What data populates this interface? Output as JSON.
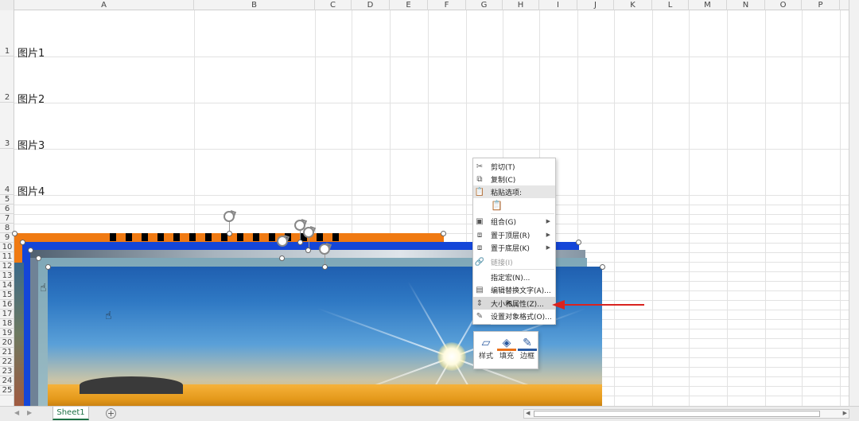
{
  "columns": [
    "A",
    "B",
    "C",
    "D",
    "E",
    "F",
    "G",
    "H",
    "I",
    "J",
    "K",
    "L",
    "M",
    "N",
    "O",
    "P"
  ],
  "rows": [
    "1",
    "2",
    "3",
    "4",
    "5",
    "6",
    "7",
    "8",
    "9",
    "10",
    "11",
    "12",
    "13",
    "14",
    "15",
    "16",
    "17",
    "18",
    "19",
    "20",
    "21",
    "22",
    "23",
    "24",
    "25"
  ],
  "cells": [
    {
      "row": "1",
      "text": "图片1"
    },
    {
      "row": "2",
      "text": "图片2"
    },
    {
      "row": "3",
      "text": "图片3"
    },
    {
      "row": "4",
      "text": "图片4"
    }
  ],
  "context_menu": {
    "items": [
      {
        "label": "剪切(T)",
        "icon": "cut-icon",
        "glyph": "✂"
      },
      {
        "label": "复制(C)",
        "icon": "copy-icon",
        "glyph": "⧉"
      },
      {
        "label": "粘贴选项:",
        "icon": "paste-icon",
        "glyph": "📋"
      },
      {
        "label": "组合(G)",
        "icon": "group-icon",
        "glyph": "▣",
        "submenu": true
      },
      {
        "label": "置于顶层(R)",
        "icon": "bring-front-icon",
        "glyph": "⧈",
        "submenu": true
      },
      {
        "label": "置于底层(K)",
        "icon": "send-back-icon",
        "glyph": "⧈",
        "submenu": true
      },
      {
        "label": "链接(I)",
        "icon": "link-icon",
        "glyph": "🔗",
        "disabled": true
      },
      {
        "label": "指定宏(N)...",
        "icon": "",
        "glyph": ""
      },
      {
        "label": "编辑替换文字(A)...",
        "icon": "alt-text-icon",
        "glyph": "▤"
      },
      {
        "label": "大小和属性(Z)...",
        "icon": "size-properties-icon",
        "glyph": "⇕",
        "highlighted": true
      },
      {
        "label": "设置对象格式(O)...",
        "icon": "format-object-icon",
        "glyph": "✎"
      }
    ]
  },
  "mini_toolbar": {
    "style_label": "样式",
    "fill_label": "填充",
    "border_label": "边框"
  },
  "sheet_tab": "Sheet1",
  "colors": {
    "accent_green": "#1e7145",
    "annotation_red": "#d9231f"
  }
}
